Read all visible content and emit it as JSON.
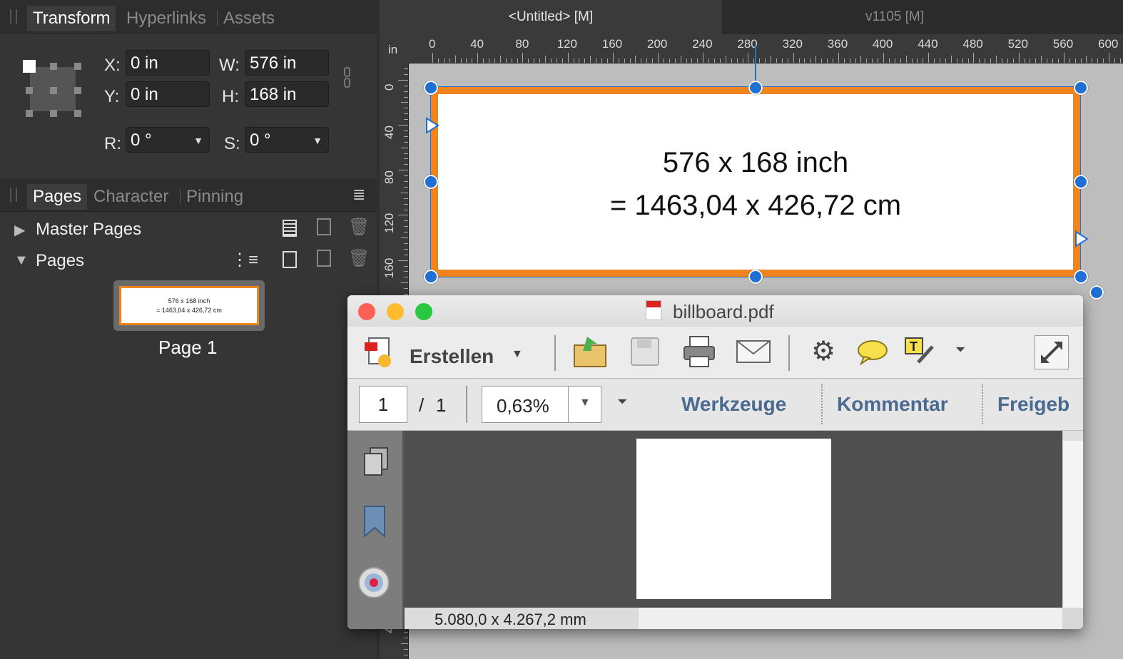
{
  "left_panel": {
    "top_tabs": [
      "Transform",
      "Hyperlinks",
      "Assets"
    ],
    "transform": {
      "x_label": "X:",
      "x_value": "0 in",
      "y_label": "Y:",
      "y_value": "0 in",
      "w_label": "W:",
      "w_value": "576 in",
      "h_label": "H:",
      "h_value": "168 in",
      "r_label": "R:",
      "r_value": "0 °",
      "s_label": "S:",
      "s_value": "0 °"
    },
    "pages_tabs": [
      "Pages",
      "Character",
      "Pinning"
    ],
    "master_pages_label": "Master Pages",
    "pages_label": "Pages",
    "thumb_line1": "576 x 168 inch",
    "thumb_line2": "= 1463,04 x 426,72 cm",
    "page_label": "Page 1"
  },
  "document": {
    "tabs": [
      "<Untitled> [M]",
      "v1105  [M]"
    ],
    "ruler_unit": "in",
    "ruler_h_labels": [
      "0",
      "40",
      "80",
      "120",
      "160",
      "200",
      "240",
      "280",
      "320",
      "360",
      "400",
      "440",
      "480",
      "520",
      "560",
      "600"
    ],
    "ruler_v_labels": [
      "0",
      "40",
      "80",
      "120",
      "160",
      "40"
    ],
    "billboard_line1": "576 x 168 inch",
    "billboard_line2": "= 1463,04 x 426,72 cm",
    "billboard_border_color": "#f0841e",
    "selection_color": "#1f6fd4"
  },
  "pdf_window": {
    "title": "billboard.pdf",
    "create_label": "Erstellen",
    "page_current": "1",
    "page_sep": "/",
    "page_total": "1",
    "zoom": "0,63%",
    "nav_tools": "Werkzeuge",
    "nav_comment": "Kommentar",
    "nav_share": "Freigeb",
    "status_size": "5.080,0 x 4.267,2 mm",
    "icons": [
      "create-pdf-icon",
      "open-icon",
      "save-icon",
      "print-icon",
      "mail-icon",
      "settings-icon",
      "comment-icon",
      "annotate-icon",
      "more-icon",
      "fullscreen-icon",
      "pages-icon",
      "bookmark-icon",
      "target-icon"
    ]
  }
}
